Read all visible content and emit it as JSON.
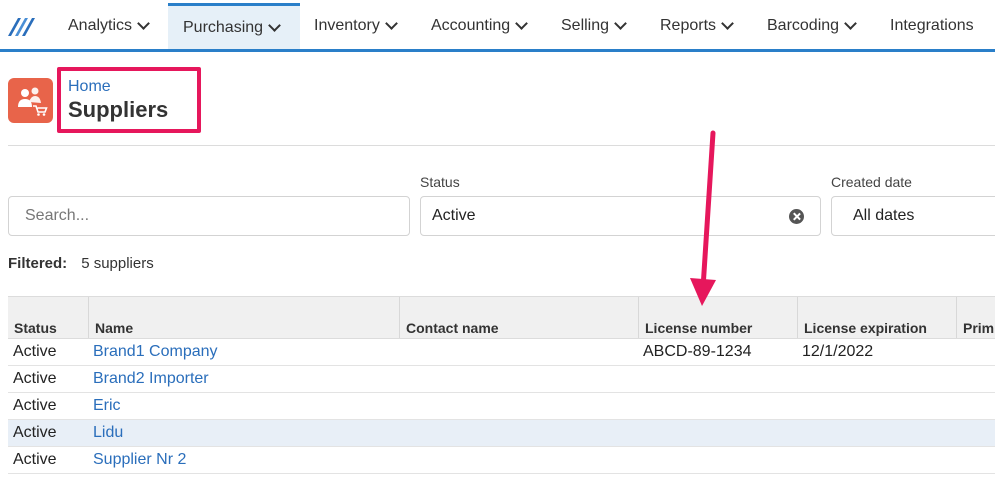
{
  "nav": {
    "items": [
      {
        "label": "Analytics"
      },
      {
        "label": "Purchasing"
      },
      {
        "label": "Inventory"
      },
      {
        "label": "Accounting"
      },
      {
        "label": "Selling"
      },
      {
        "label": "Reports"
      },
      {
        "label": "Barcoding"
      },
      {
        "label": "Integrations"
      }
    ],
    "active": "Purchasing",
    "accent_color": "#2a7fc9"
  },
  "header": {
    "breadcrumb": "Home",
    "title": "Suppliers",
    "icon": "suppliers-icon",
    "icon_color": "#e8644a",
    "highlight_color": "#e6175c"
  },
  "filters": {
    "search": {
      "placeholder": "Search..."
    },
    "status": {
      "label": "Status",
      "value": "Active"
    },
    "created_date": {
      "label": "Created date",
      "value": "All dates"
    }
  },
  "summary": {
    "label": "Filtered:",
    "value": "5 suppliers"
  },
  "table": {
    "columns": [
      "Status",
      "Name",
      "Contact name",
      "License number",
      "License expiration",
      "Prim"
    ],
    "rows": [
      {
        "status": "Active",
        "name": "Brand1 Company",
        "contact": "",
        "license": "ABCD-89-1234",
        "expiration": "12/1/2022"
      },
      {
        "status": "Active",
        "name": "Brand2 Importer",
        "contact": "",
        "license": "",
        "expiration": ""
      },
      {
        "status": "Active",
        "name": "Eric",
        "contact": "",
        "license": "",
        "expiration": ""
      },
      {
        "status": "Active",
        "name": "Lidu",
        "contact": "",
        "license": "",
        "expiration": ""
      },
      {
        "status": "Active",
        "name": "Supplier Nr 2",
        "contact": "",
        "license": "",
        "expiration": ""
      }
    ]
  },
  "annotation": {
    "arrow_color": "#e6175c"
  }
}
